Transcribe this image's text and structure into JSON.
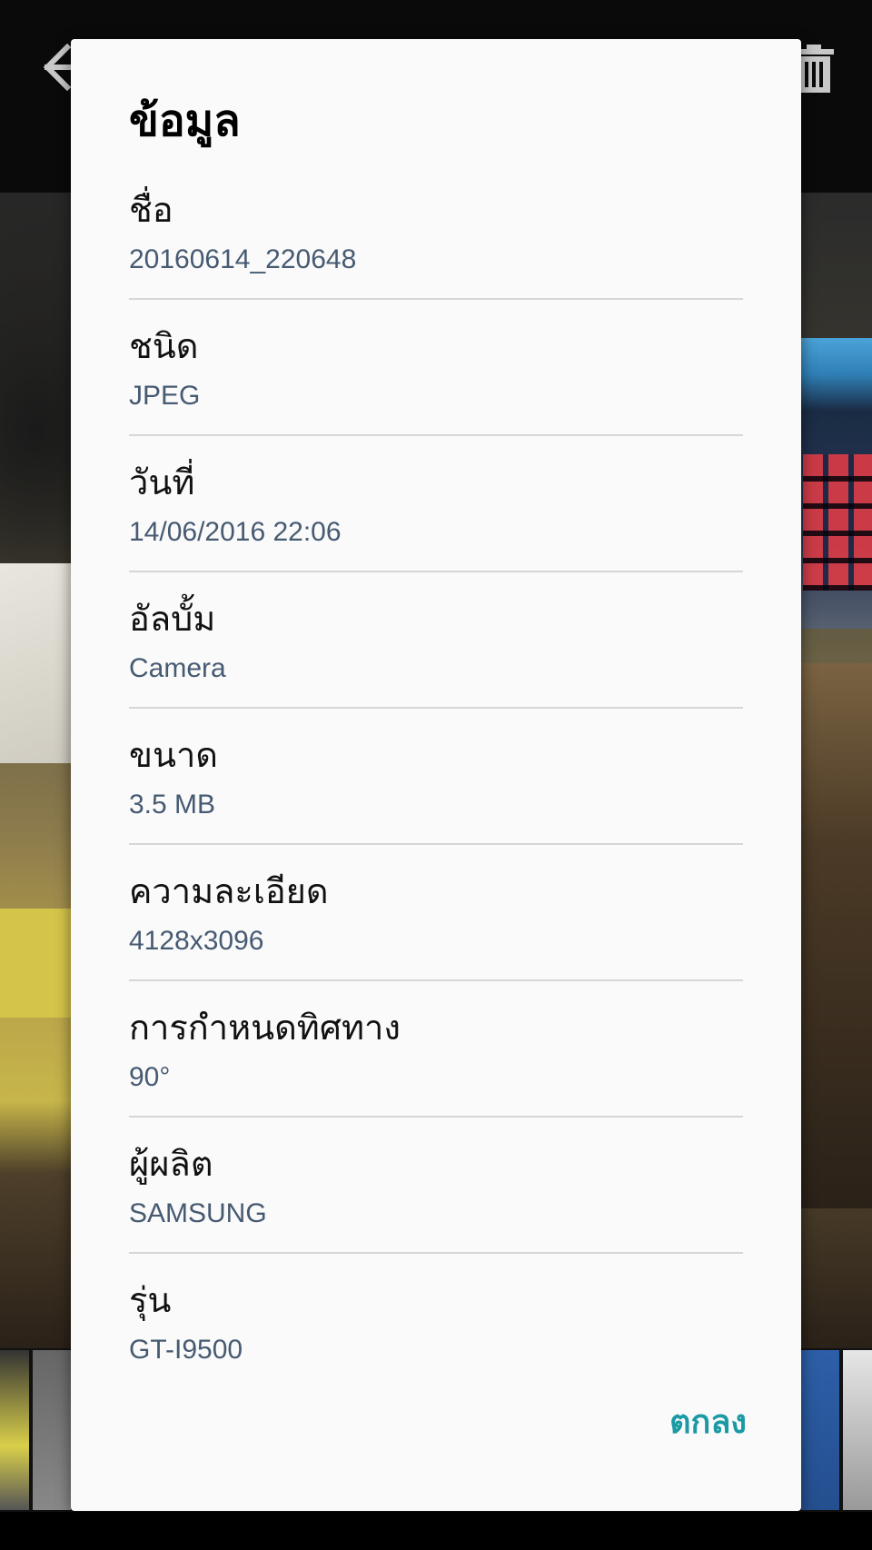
{
  "background": {
    "top_bar": {
      "back_icon": "arrow-left-icon",
      "delete_icon": "trash-icon"
    }
  },
  "dialog": {
    "title": "ข้อมูล",
    "items": [
      {
        "label": "ชื่อ",
        "value": "20160614_220648"
      },
      {
        "label": "ชนิด",
        "value": "JPEG"
      },
      {
        "label": "วันที่",
        "value": "14/06/2016 22:06"
      },
      {
        "label": "อัลบั้ม",
        "value": "Camera"
      },
      {
        "label": "ขนาด",
        "value": "3.5 MB"
      },
      {
        "label": "ความละเอียด",
        "value": "4128x3096"
      },
      {
        "label": "การกำหนดทิศทาง",
        "value": "90°"
      },
      {
        "label": "ผู้ผลิต",
        "value": "SAMSUNG"
      },
      {
        "label": "รุ่น",
        "value": "GT-I9500"
      }
    ],
    "ok_label": "ตกลง"
  },
  "colors": {
    "dialog_bg": "#fafafa",
    "value_text": "#465a72",
    "accent": "#1b9aa6",
    "divider": "#d6d6d6"
  }
}
